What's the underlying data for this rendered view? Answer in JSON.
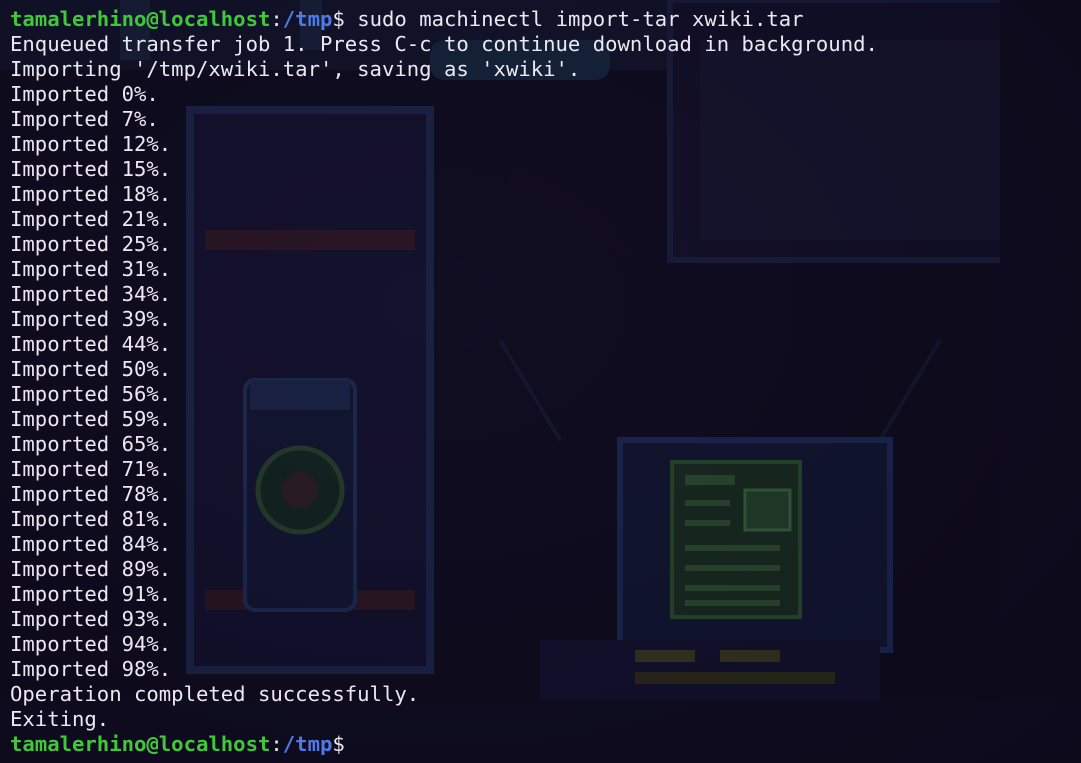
{
  "prompt": {
    "user_host": "tamalerhino@localhost",
    "separator": ":",
    "cwd": "/tmp",
    "symbol": "$",
    "command": " sudo machinectl import-tar xwiki.tar"
  },
  "output": [
    "Enqueued transfer job 1. Press C-c to continue download in background.",
    "Importing '/tmp/xwiki.tar', saving as 'xwiki'.",
    "Imported 0%.",
    "Imported 7%.",
    "Imported 12%.",
    "Imported 15%.",
    "Imported 18%.",
    "Imported 21%.",
    "Imported 25%.",
    "Imported 31%.",
    "Imported 34%.",
    "Imported 39%.",
    "Imported 44%.",
    "Imported 50%.",
    "Imported 56%.",
    "Imported 59%.",
    "Imported 65%.",
    "Imported 71%.",
    "Imported 78%.",
    "Imported 81%.",
    "Imported 84%.",
    "Imported 89%.",
    "Imported 91%.",
    "Imported 93%.",
    "Imported 94%.",
    "Imported 98%.",
    "Operation completed successfully.",
    "Exiting."
  ],
  "final_prompt": {
    "user_host": "tamalerhino@localhost",
    "separator": ":",
    "cwd": "/tmp",
    "symbol": "$"
  },
  "colors": {
    "background": "#0e0b1d",
    "text": "#ece8f2",
    "user_host": "#3fc93a",
    "cwd": "#4f79e6"
  }
}
